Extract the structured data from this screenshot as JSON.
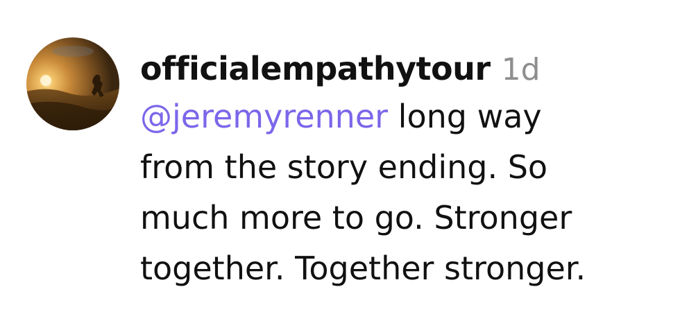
{
  "comment": {
    "avatar_icon": "profile-avatar-sunset-silhouette",
    "username": "officialempathytour",
    "timestamp": "1d",
    "mention": "@jeremyrenner",
    "text_line1": " long way",
    "text_line2": "from the story ending. So",
    "text_line3": "much more to go. Stronger",
    "text_line4": "together. Together stronger."
  },
  "colors": {
    "mention": "#7b66ea",
    "timestamp": "#8e8e8e",
    "text": "#111111"
  }
}
